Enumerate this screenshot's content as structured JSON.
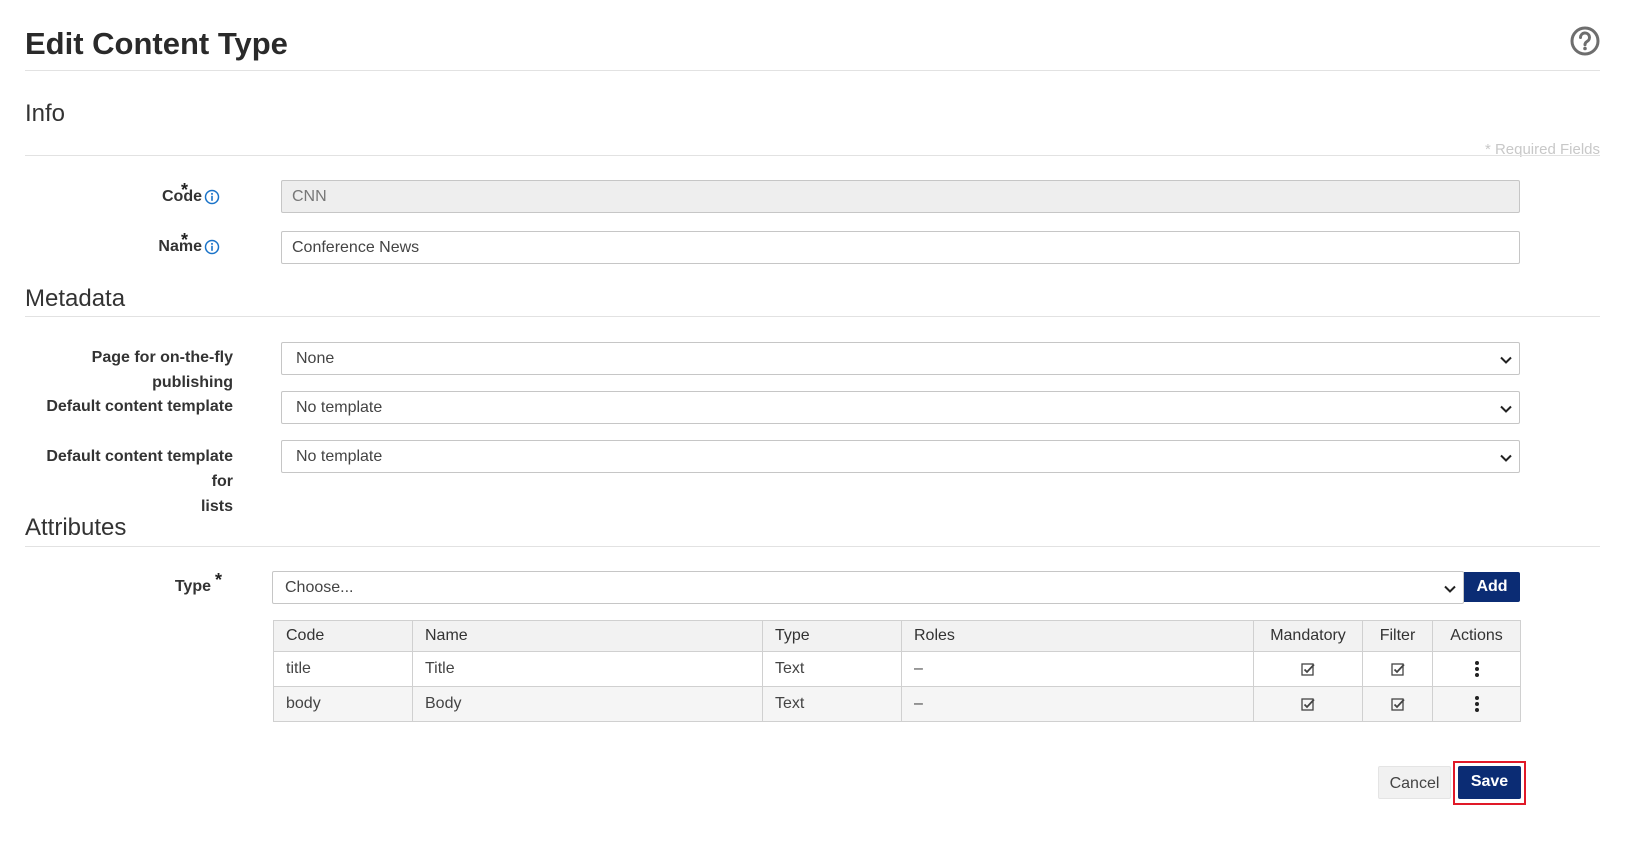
{
  "page": {
    "title": "Edit Content Type"
  },
  "info": {
    "section_title": "Info",
    "required_note": "* Required Fields",
    "code": {
      "label": "Code",
      "value": "CNN"
    },
    "name": {
      "label": "Name",
      "value": "Conference News"
    }
  },
  "metadata": {
    "section_title": "Metadata",
    "page_publishing": {
      "label": "Page for on-the-fly publishing",
      "value": "None"
    },
    "default_template": {
      "label": "Default content template",
      "value": "No template"
    },
    "default_template_lists": {
      "label_line1": "Default content template for",
      "label_line2": "lists",
      "value": "No template"
    }
  },
  "attributes": {
    "section_title": "Attributes",
    "type": {
      "label": "Type",
      "value": "Choose..."
    },
    "add_label": "Add",
    "table": {
      "headers": [
        "Code",
        "Name",
        "Type",
        "Roles",
        "Mandatory",
        "Filter",
        "Actions"
      ],
      "rows": [
        {
          "code": "title",
          "name": "Title",
          "type": "Text",
          "roles": "–",
          "mandatory": true,
          "filter": true
        },
        {
          "code": "body",
          "name": "Body",
          "type": "Text",
          "roles": "–",
          "mandatory": true,
          "filter": true
        }
      ]
    }
  },
  "footer": {
    "cancel_label": "Cancel",
    "save_label": "Save"
  },
  "colors": {
    "primary": "#0b2c74",
    "highlight": "#e01928",
    "info_icon": "#1a73c8"
  }
}
